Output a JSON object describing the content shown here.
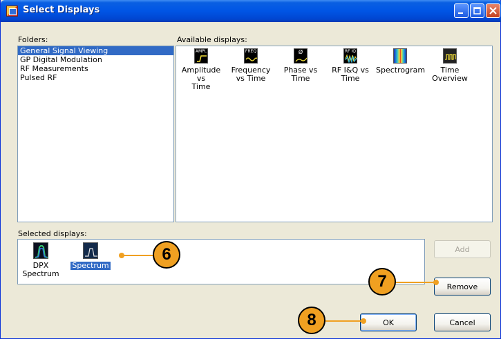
{
  "window": {
    "title": "Select Displays"
  },
  "folders": {
    "label": "Folders:",
    "items": [
      "General Signal Viewing",
      "GP Digital Modulation",
      "RF Measurements",
      "Pulsed RF"
    ],
    "selected_index": 0
  },
  "available": {
    "label": "Available displays:",
    "items": [
      {
        "name": "Amplitude vs Time",
        "line1": "Amplitude vs",
        "line2": "Time",
        "icon": "amplitude-icon",
        "icon_text": "AMPL"
      },
      {
        "name": "Frequency vs Time",
        "line1": "Frequency",
        "line2": "vs Time",
        "icon": "frequency-icon",
        "icon_text": "FREQ"
      },
      {
        "name": "Phase vs Time",
        "line1": "Phase vs",
        "line2": "Time",
        "icon": "phase-icon",
        "icon_text": "Ø"
      },
      {
        "name": "RF I&Q vs Time",
        "line1": "RF I&Q vs",
        "line2": "Time",
        "icon": "rf-iq-icon",
        "icon_text": "RF IQ"
      },
      {
        "name": "Spectrogram",
        "line1": "Spectrogram",
        "line2": "",
        "icon": "spectrogram-icon",
        "icon_text": ""
      },
      {
        "name": "Time Overview",
        "line1": "Time",
        "line2": "Overview",
        "icon": "time-overview-icon",
        "icon_text": ""
      }
    ]
  },
  "selected": {
    "label": "Selected displays:",
    "items": [
      {
        "line1": "DPX",
        "line2": "Spectrum",
        "icon": "dpx-spectrum-icon"
      },
      {
        "line1": "Spectrum",
        "line2": "",
        "icon": "spectrum-icon",
        "highlighted": true
      }
    ]
  },
  "buttons": {
    "add": "Add",
    "remove": "Remove",
    "ok": "OK",
    "cancel": "Cancel"
  },
  "callouts": [
    "6",
    "7",
    "8"
  ],
  "colors": {
    "callout": "#f0a021",
    "selection": "#316ac5",
    "titlebar": "#0055e5"
  }
}
